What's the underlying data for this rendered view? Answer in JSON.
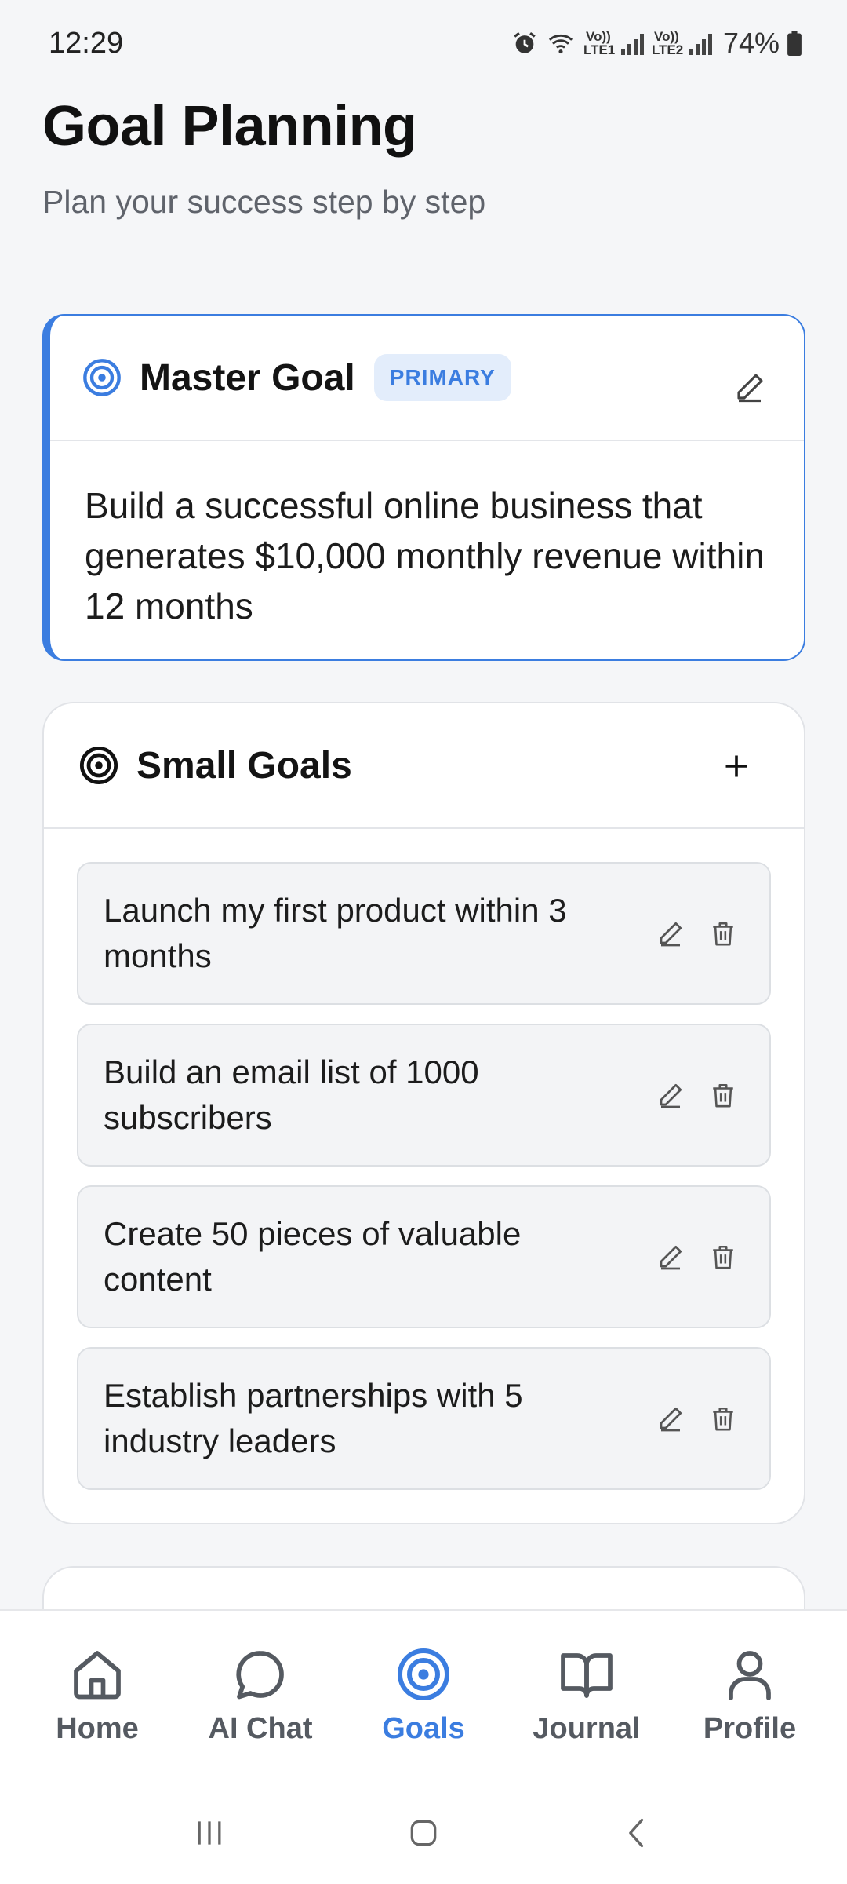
{
  "status_bar": {
    "time": "12:29",
    "sim1": "Vo)) LTE1",
    "sim2": "Vo)) LTE2",
    "battery": "74%"
  },
  "header": {
    "title": "Goal Planning",
    "subtitle": "Plan your success step by step"
  },
  "master_goal": {
    "title": "Master Goal",
    "badge": "PRIMARY",
    "description": "Build a successful online business that generates $10,000 monthly revenue within 12 months"
  },
  "small_goals": {
    "title": "Small Goals",
    "items": [
      {
        "text": "Launch my first product within 3 months"
      },
      {
        "text": "Build an email list of 1000 subscribers"
      },
      {
        "text": "Create 50 pieces of valuable content"
      },
      {
        "text": "Establish partnerships with 5 industry leaders"
      }
    ]
  },
  "bottom_nav": {
    "items": [
      {
        "label": "Home",
        "icon": "home-icon"
      },
      {
        "label": "AI Chat",
        "icon": "chat-icon"
      },
      {
        "label": "Goals",
        "icon": "target-icon",
        "active": true
      },
      {
        "label": "Journal",
        "icon": "book-icon"
      },
      {
        "label": "Profile",
        "icon": "user-icon"
      }
    ]
  },
  "colors": {
    "accent": "#3b7de0",
    "background": "#f5f6f8",
    "card": "#ffffff",
    "goal_item_bg": "#f3f4f6"
  }
}
